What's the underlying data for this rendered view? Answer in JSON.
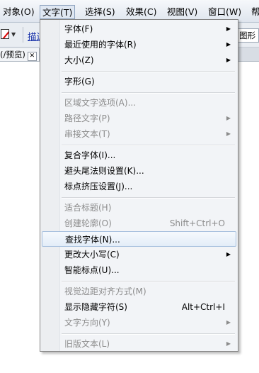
{
  "menubar": {
    "items": [
      "对象(O)",
      "文字(T)",
      "选择(S)",
      "效果(C)",
      "视图(V)",
      "窗口(W)",
      "帮"
    ]
  },
  "toolbar": {
    "link_label": "描边",
    "shape_label": "图形"
  },
  "document_tab": {
    "title": "(/预览)",
    "close_symbol": "✕"
  },
  "type_menu": {
    "items": [
      {
        "label": "字体(F)",
        "submenu": true,
        "enabled": true
      },
      {
        "label": "最近使用的字体(R)",
        "submenu": true,
        "enabled": true
      },
      {
        "label": "大小(Z)",
        "submenu": true,
        "enabled": true
      },
      {
        "label": "字形(G)",
        "enabled": true
      },
      {
        "label": "区域文字选项(A)...",
        "enabled": false
      },
      {
        "label": "路径文字(P)",
        "submenu": true,
        "enabled": false
      },
      {
        "label": "串接文本(T)",
        "submenu": true,
        "enabled": false
      },
      {
        "label": "复合字体(I)...",
        "enabled": true
      },
      {
        "label": "避头尾法则设置(K)...",
        "enabled": true
      },
      {
        "label": "标点挤压设置(J)...",
        "enabled": true
      },
      {
        "label": "适合标题(H)",
        "enabled": false
      },
      {
        "label": "创建轮廓(O)",
        "shortcut": "Shift+Ctrl+O",
        "enabled": false
      },
      {
        "label": "查找字体(N)...",
        "enabled": true,
        "highlighted": true
      },
      {
        "label": "更改大小写(C)",
        "submenu": true,
        "enabled": true
      },
      {
        "label": "智能标点(U)...",
        "enabled": true
      },
      {
        "label": "视觉边距对齐方式(M)",
        "enabled": false
      },
      {
        "label": "显示隐藏字符(S)",
        "shortcut": "Alt+Ctrl+I",
        "enabled": true
      },
      {
        "label": "文字方向(Y)",
        "submenu": true,
        "enabled": false
      },
      {
        "label": "旧版文本(L)",
        "submenu": true,
        "enabled": false
      }
    ],
    "submenu_arrow": "▶"
  }
}
